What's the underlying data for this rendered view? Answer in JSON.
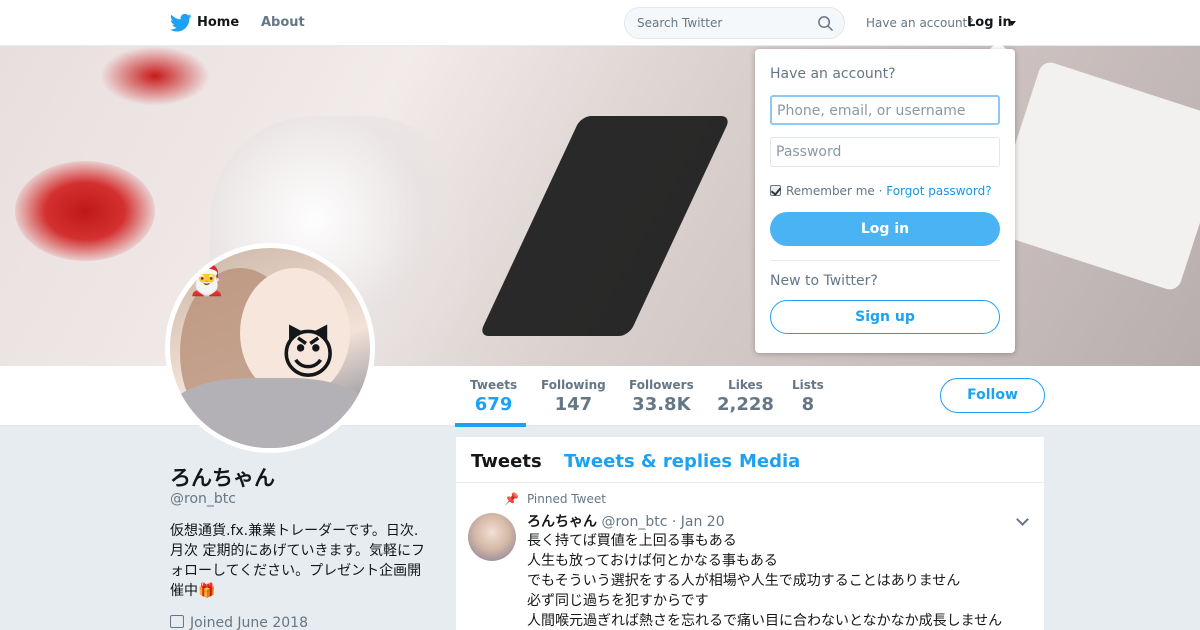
{
  "nav": {
    "home_label": "Home",
    "about_label": "About",
    "search_placeholder": "Search Twitter",
    "have_account": "Have an account?",
    "login_label": "Log in"
  },
  "profile": {
    "name": "ろんちゃん",
    "handle": "@ron_btc",
    "bio": "仮想通貨.fx.兼業トレーダーです。日次.月次 定期的にあげていきます。気軽にフォローしてください。プレゼント企画開催中🎁",
    "joined": "Joined June 2018"
  },
  "stats": [
    {
      "label": "Tweets",
      "value": "679"
    },
    {
      "label": "Following",
      "value": "147"
    },
    {
      "label": "Followers",
      "value": "33.8K"
    },
    {
      "label": "Likes",
      "value": "2,228"
    },
    {
      "label": "Lists",
      "value": "8"
    }
  ],
  "follow_label": "Follow",
  "tabs": [
    "Tweets",
    "Tweets & replies",
    "Media"
  ],
  "pinned": {
    "label": "Pinned Tweet",
    "name": "ろんちゃん",
    "meta": "@ron_btc · Jan 20",
    "lines": [
      "長く持てば買値を上回る事もある",
      "人生も放っておけば何とかなる事もある",
      "でもそういう選択をする人が相場や人生で成功することはありません",
      "必ず同じ過ちを犯すからです",
      "人間喉元過ぎれば熱さを忘れるで痛い目に合わないとなかなか成長しません"
    ]
  },
  "login_dropdown": {
    "title": "Have an account?",
    "username_placeholder": "Phone, email, or username",
    "password_placeholder": "Password",
    "remember": "Remember me ·",
    "forgot": "Forgot password?",
    "login_button": "Log in",
    "new_to": "New to Twitter?",
    "signup_button": "Sign up"
  },
  "colors": {
    "accent": "#1da1f2",
    "button_blue": "#4ab3f4",
    "muted": "#657786",
    "background": "#e6ecf0"
  },
  "icons": [
    "twitter-bird-icon",
    "search-icon",
    "caret-down-icon",
    "pin-icon",
    "calendar-icon",
    "chevron-down-icon"
  ]
}
